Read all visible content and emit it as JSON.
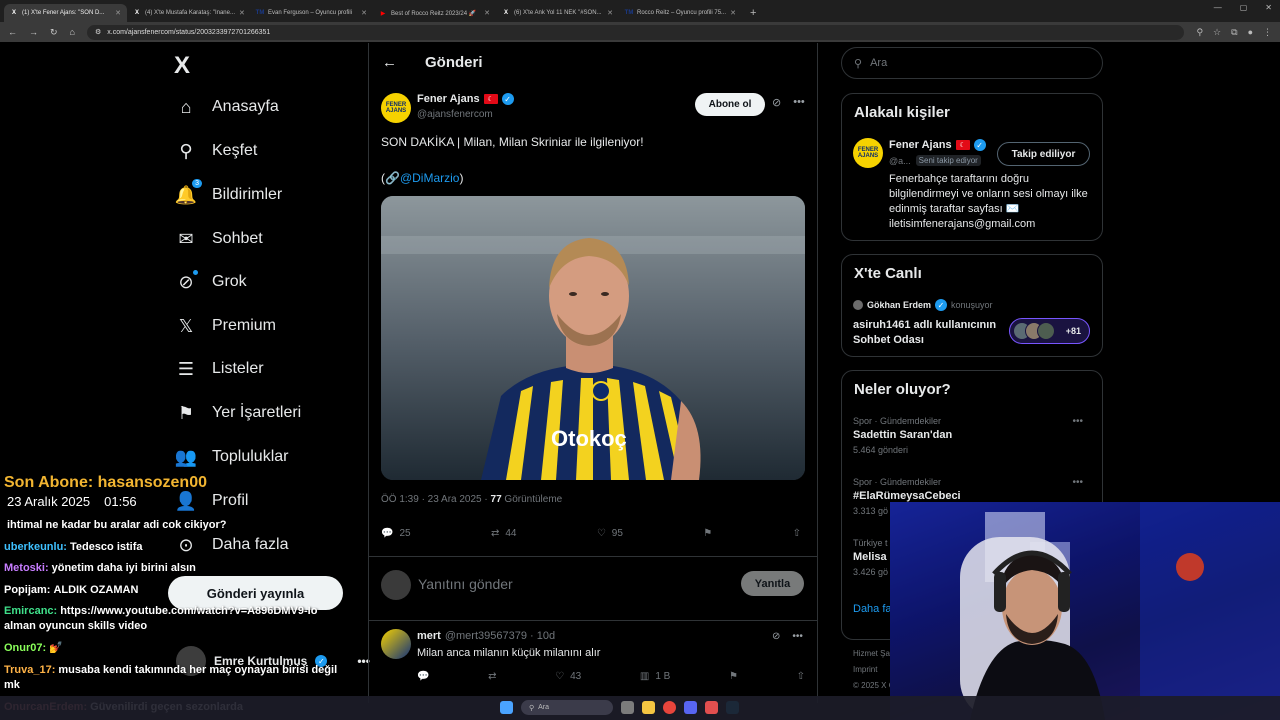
{
  "browser": {
    "tabs": [
      {
        "title": "(1) X'te Fener Ajans: \"SON D...",
        "favicon": "X",
        "fav_color": "#ffffff",
        "active": true
      },
      {
        "title": "(4) X'te Mustafa Karataş: \"Inane...",
        "favicon": "X",
        "fav_color": "#ffffff",
        "active": false
      },
      {
        "title": "Evan Ferguson – Oyuncu profili",
        "favicon": "TM",
        "fav_color": "#1a3a8a",
        "active": false
      },
      {
        "title": "Best of Rocco Reitz 2023/24 🚀",
        "favicon": "▶",
        "fav_color": "#ff0000",
        "active": false
      },
      {
        "title": "(6) X'te Ank Yol 11 NEK \"#SON...",
        "favicon": "X",
        "fav_color": "#ffffff",
        "active": false
      },
      {
        "title": "Rocco Reitz – Oyuncu profili 75...",
        "favicon": "TM",
        "fav_color": "#1a3a8a",
        "active": false
      }
    ],
    "url": "x.com/ajansfenercom/status/2003233972701266351"
  },
  "nav": {
    "logo": "X",
    "items": [
      {
        "label": "Anasayfa",
        "icon": "home-icon",
        "glyph": "⌂"
      },
      {
        "label": "Keşfet",
        "icon": "search-icon",
        "glyph": "⚲"
      },
      {
        "label": "Bildirimler",
        "icon": "bell-icon",
        "glyph": "🔔",
        "badge": "3"
      },
      {
        "label": "Sohbet",
        "icon": "mail-icon",
        "glyph": "✉"
      },
      {
        "label": "Grok",
        "icon": "grok-icon",
        "glyph": "⊘"
      },
      {
        "label": "Premium",
        "icon": "x-premium-icon",
        "glyph": "𝕏"
      },
      {
        "label": "Listeler",
        "icon": "list-icon",
        "glyph": "☰"
      },
      {
        "label": "Yer İşaretleri",
        "icon": "bookmark-icon",
        "glyph": "⚑"
      },
      {
        "label": "Topluluklar",
        "icon": "communities-icon",
        "glyph": "👥"
      },
      {
        "label": "Profil",
        "icon": "profile-icon",
        "glyph": "👤"
      },
      {
        "label": "Daha fazla",
        "icon": "more-circle-icon",
        "glyph": "⊙"
      }
    ],
    "post_button": "Gönderi yayınla",
    "account_name": "Emre Kurtulmuş"
  },
  "main": {
    "header_title": "Gönderi",
    "post": {
      "author": "Fener Ajans",
      "avatar_text": "FENER AJANS",
      "handle": "@ajansfenercom",
      "follow_label": "Abone ol",
      "text": "SON DAKİKA | Milan, Milan Skriniar ile ilgileniyor!",
      "link_prefix": "(🔗",
      "mention": "@DiMarzio",
      "link_suffix": ")",
      "time": "ÖÖ 1:39 · 23 Ara 2025 · ",
      "views": "77",
      "views_label": " Görüntüleme",
      "replies": "25",
      "reposts": "44",
      "likes": "95"
    },
    "reply_placeholder": "Yanıtını gönder",
    "reply_button": "Yanıtla",
    "comment": {
      "name": "mert",
      "handle": "@mert39567379 · 10d",
      "text": "Milan anca milanın küçük milanını alır",
      "likes": "43",
      "views": "1 B"
    }
  },
  "right": {
    "search_placeholder": "Ara",
    "relevant": {
      "title": "Alakalı kişiler",
      "name": "Fener Ajans",
      "avatar_text": "FENER AJANS",
      "handle": "@a...",
      "follows_you": "Seni takip ediyor",
      "button": "Takip ediliyor",
      "bio": "Fenerbahçe taraftarını doğru bilgilendirmeyi ve onların sesi olmayı ilke edinmiş taraftar sayfası ✉️ iletisimfenerajans@gmail.com"
    },
    "live": {
      "title": "X'te Canlı",
      "host": "Gökhan Erdem",
      "host_status": "konuşuyor",
      "room": "asiruh1461 adlı kullanıcının Sohbet Odası",
      "listeners": "+81"
    },
    "trends": {
      "title": "Neler oluyor?",
      "items": [
        {
          "category": "Spor · Gündemdekiler",
          "name": "Sadettin Saran'dan",
          "count": "5.464 gönderi"
        },
        {
          "category": "Spor · Gündemdekiler",
          "name": "#ElaRümeysaCebeci",
          "count": "3.313 gö"
        },
        {
          "category": "Türkiye t",
          "name": "Melisa I",
          "count": "3.426 gö"
        }
      ],
      "show_more": "Daha fa"
    },
    "footer": [
      "Hizmet Şa",
      "Imprint",
      "© 2025 X C"
    ]
  },
  "overlay": {
    "subscriber": "Son Abone: hasansozen00",
    "date": "23 Aralık 2025",
    "time": "01:56",
    "chat": [
      {
        "user": "",
        "user_color": "#ffffff",
        "text": "ihtimal ne kadar bu aralar adi cok cikiyor?"
      },
      {
        "user": "uberkeunlu:",
        "user_color": "#3fc1ff",
        "text": "Tedesco istifa"
      },
      {
        "user": "Metoski:",
        "user_color": "#c77dff",
        "text": "yönetim daha iyi birini alsın"
      },
      {
        "user": "Popijam:",
        "user_color": "#ffffff",
        "text": "ALDIK OZAMAN"
      },
      {
        "user": "Emircanc:",
        "user_color": "#3fe08a",
        "text": "https://www.youtube.com/watch?v=A896DMV9-Io alman oyuncun skills video"
      },
      {
        "user": "Onur07:",
        "user_color": "#8aff5a",
        "text": "💅"
      },
      {
        "user": "Truva_17:",
        "user_color": "#ffb347",
        "text": "musaba kendi takımında her maç oynayan birisi değil mk"
      },
      {
        "user": "OnurcanErdem:",
        "user_color": "#ff8c8c",
        "text": "Güvenilirdi geçen sezonlarda"
      }
    ]
  },
  "taskbar": {
    "search": "Ara"
  },
  "colors": {
    "accent": "#1d9bf0",
    "bg": "#000000",
    "border": "#2f3336",
    "muted": "#71767b"
  }
}
